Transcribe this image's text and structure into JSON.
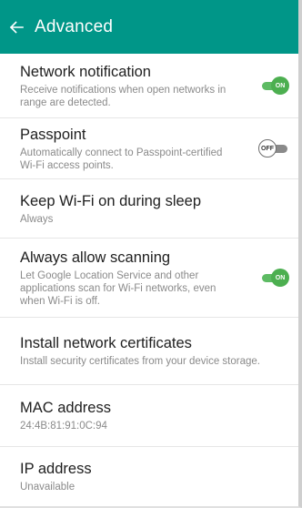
{
  "colors": {
    "app_bar": "#009688",
    "toggle_on": "#4caf50",
    "toggle_off": "#8a8a8a"
  },
  "header": {
    "back_icon": "arrow-left-icon",
    "title": "Advanced"
  },
  "settings": [
    {
      "title": "Network notification",
      "subtitle": "Receive notifications when open networks in range are detected.",
      "toggle": "ON"
    },
    {
      "title": "Passpoint",
      "subtitle": "Automatically connect to Passpoint-certified Wi-Fi access points.",
      "toggle": "OFF"
    },
    {
      "title": "Keep Wi-Fi on during sleep",
      "subtitle": "Always"
    },
    {
      "title": "Always allow scanning",
      "subtitle": "Let Google Location Service and other applications scan for Wi-Fi networks, even when Wi-Fi is off.",
      "toggle": "ON"
    },
    {
      "title": "Install network certificates",
      "subtitle": "Install security certificates from your device storage."
    },
    {
      "title": "MAC address",
      "subtitle": "24:4B:81:91:0C:94"
    },
    {
      "title": "IP address",
      "subtitle": "Unavailable"
    }
  ]
}
